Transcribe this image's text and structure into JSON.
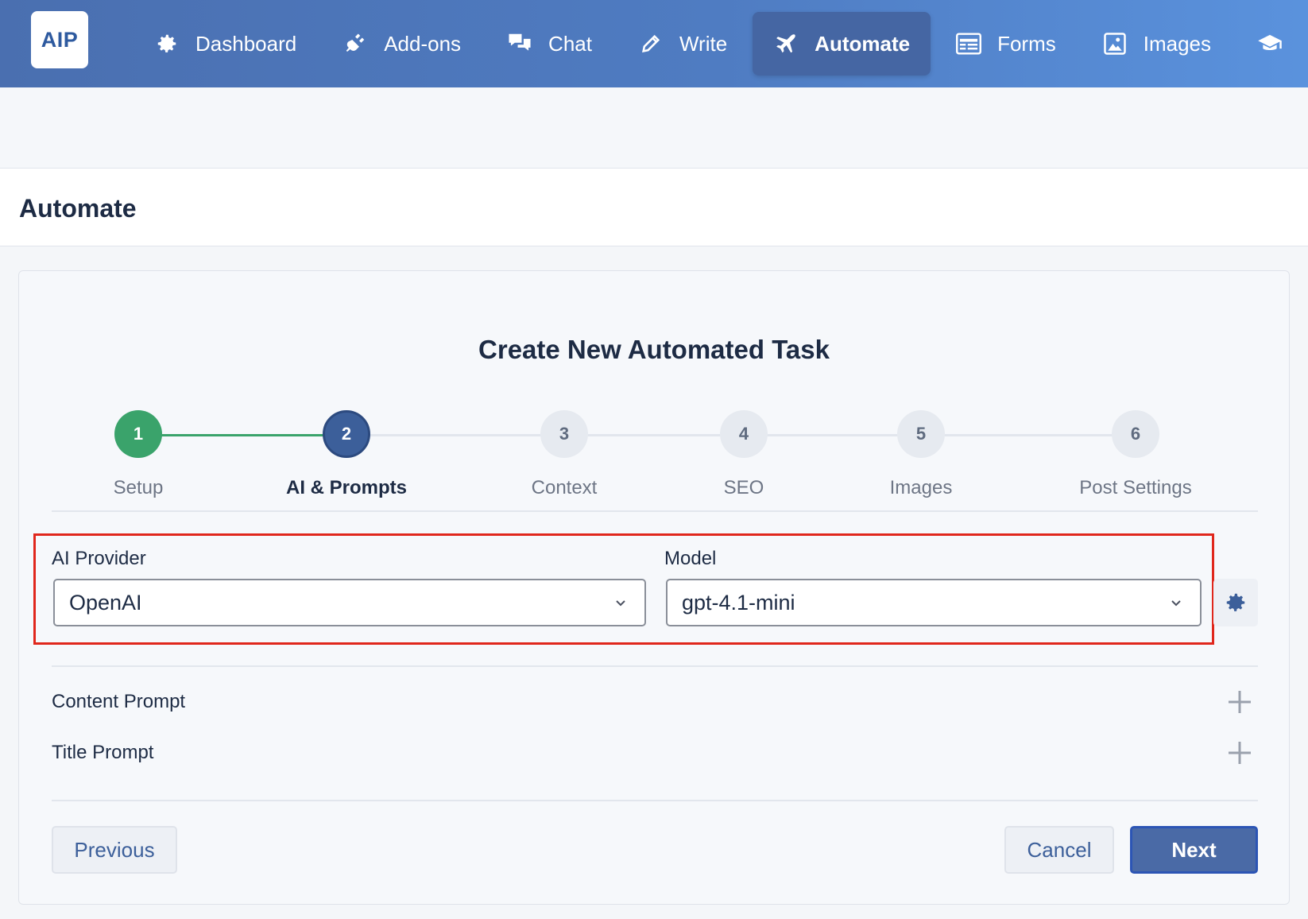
{
  "app": {
    "logo_text": "AIP"
  },
  "nav": {
    "items": [
      {
        "label": "Dashboard",
        "icon": "gear-icon",
        "active": false
      },
      {
        "label": "Add-ons",
        "icon": "plug-icon",
        "active": false
      },
      {
        "label": "Chat",
        "icon": "chat-icon",
        "active": false
      },
      {
        "label": "Write",
        "icon": "pencil-icon",
        "active": false
      },
      {
        "label": "Automate",
        "icon": "plane-icon",
        "active": true
      },
      {
        "label": "Forms",
        "icon": "form-icon",
        "active": false
      },
      {
        "label": "Images",
        "icon": "image-icon",
        "active": false
      },
      {
        "label": "",
        "icon": "graduation-cap-icon",
        "active": false
      }
    ]
  },
  "page": {
    "title": "Automate"
  },
  "wizard": {
    "title": "Create New Automated Task",
    "steps": [
      {
        "number": "1",
        "label": "Setup",
        "state": "done"
      },
      {
        "number": "2",
        "label": "AI & Prompts",
        "state": "current"
      },
      {
        "number": "3",
        "label": "Context",
        "state": "pending"
      },
      {
        "number": "4",
        "label": "SEO",
        "state": "pending"
      },
      {
        "number": "5",
        "label": "Images",
        "state": "pending"
      },
      {
        "number": "6",
        "label": "Post Settings",
        "state": "pending"
      }
    ],
    "provider": {
      "label": "AI Provider",
      "value": "OpenAI"
    },
    "model": {
      "label": "Model",
      "value": "gpt-4.1-mini"
    },
    "sections": [
      {
        "label": "Content Prompt"
      },
      {
        "label": "Title Prompt"
      }
    ],
    "buttons": {
      "previous": "Previous",
      "cancel": "Cancel",
      "next": "Next"
    }
  },
  "colors": {
    "accent": "#3c5f9a",
    "done": "#3aa36b",
    "highlight": "#e0271c"
  }
}
